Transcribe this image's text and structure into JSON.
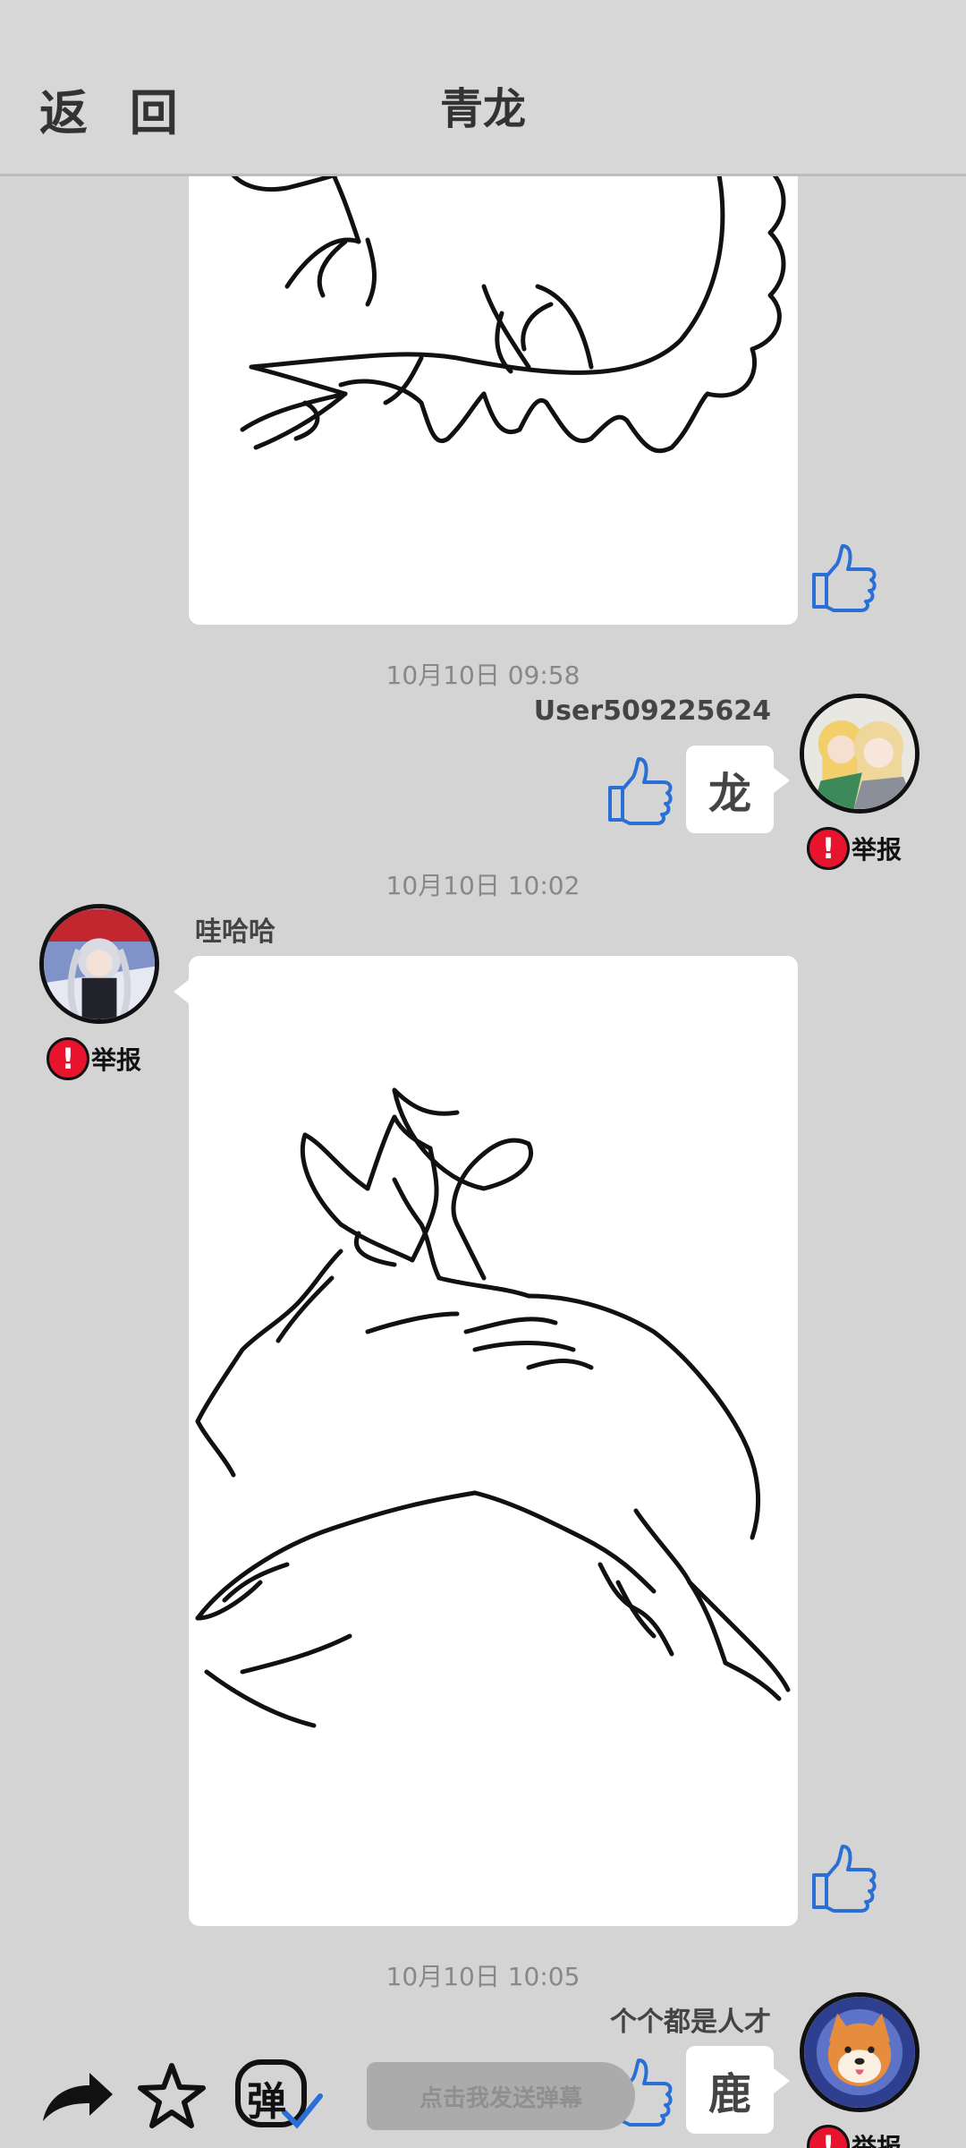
{
  "header": {
    "back_label": "返 回",
    "title": "青龙"
  },
  "messages": [
    {
      "timestamp": "10月10日  09:58",
      "username": "User509225624",
      "text": "龙",
      "report_label": "举报"
    },
    {
      "timestamp": "10月10日  10:02",
      "username": "哇哈哈",
      "report_label": "举报"
    },
    {
      "timestamp": "10月10日  10:05",
      "username": "个个都是人才",
      "text": "鹿",
      "report_label": "举报"
    }
  ],
  "toolbar": {
    "share_icon": "share-arrow-icon",
    "favorite_icon": "star-icon",
    "danmaku_toggle_label": "弹",
    "danmaku_placeholder": "点击我发送弹幕"
  },
  "colors": {
    "background": "#d4d4d4",
    "thumb_blue": "#2a6fd6",
    "report_red": "#e8132c"
  }
}
